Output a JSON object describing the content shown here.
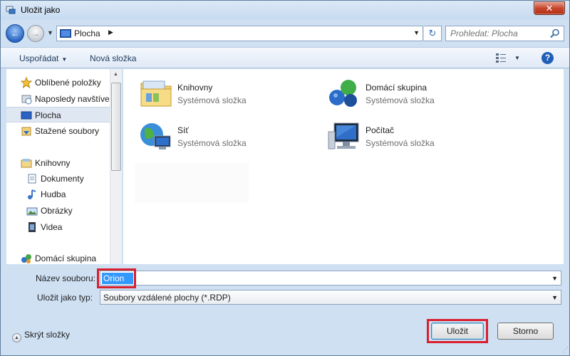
{
  "window": {
    "title": "Uložit jako",
    "close_label": "✕"
  },
  "address": {
    "path": "Plocha",
    "refresh_glyph": "↻",
    "back_glyph": "←",
    "forward_glyph": "→"
  },
  "search": {
    "placeholder": "Prohledat: Plocha"
  },
  "toolbar": {
    "organize_label": "Uspořádat",
    "new_folder_label": "Nová složka",
    "help_label": "?"
  },
  "nav": {
    "items": [
      {
        "label": "Oblíbené položky",
        "icon": "star-icon"
      },
      {
        "label": "Naposledy navštíveno",
        "icon": "recent-places-icon"
      },
      {
        "label": "Plocha",
        "icon": "desktop-icon",
        "selected": true
      },
      {
        "label": "Stažené soubory",
        "icon": "downloads-icon"
      },
      {
        "label": "Knihovny",
        "icon": "libraries-icon"
      },
      {
        "label": "Dokumenty",
        "icon": "documents-icon"
      },
      {
        "label": "Hudba",
        "icon": "music-icon"
      },
      {
        "label": "Obrázky",
        "icon": "pictures-icon"
      },
      {
        "label": "Videa",
        "icon": "videos-icon"
      },
      {
        "label": "Domácí skupina",
        "icon": "homegroup-icon"
      }
    ]
  },
  "content": {
    "tiles": [
      {
        "name": "Knihovny",
        "desc": "Systémová složka",
        "icon": "libraries-folder-icon"
      },
      {
        "name": "Domácí skupina",
        "desc": "Systémová složka",
        "icon": "homegroup-icon"
      },
      {
        "name": "Síť",
        "desc": "Systémová složka",
        "icon": "network-icon"
      },
      {
        "name": "Počítač",
        "desc": "Systémová složka",
        "icon": "computer-icon"
      }
    ]
  },
  "form": {
    "filename_label": "Název souboru:",
    "filename_value": "Orion",
    "filetype_label": "Uložit jako typ:",
    "filetype_value": "Soubory vzdálené plochy (*.RDP)"
  },
  "footer": {
    "hide_folders_label": "Skrýt složky",
    "save_label": "Uložit",
    "cancel_label": "Storno"
  },
  "colors": {
    "highlight_box": "#d8202f",
    "selection": "#3399ff",
    "window_frame": "#cfe0f3"
  }
}
